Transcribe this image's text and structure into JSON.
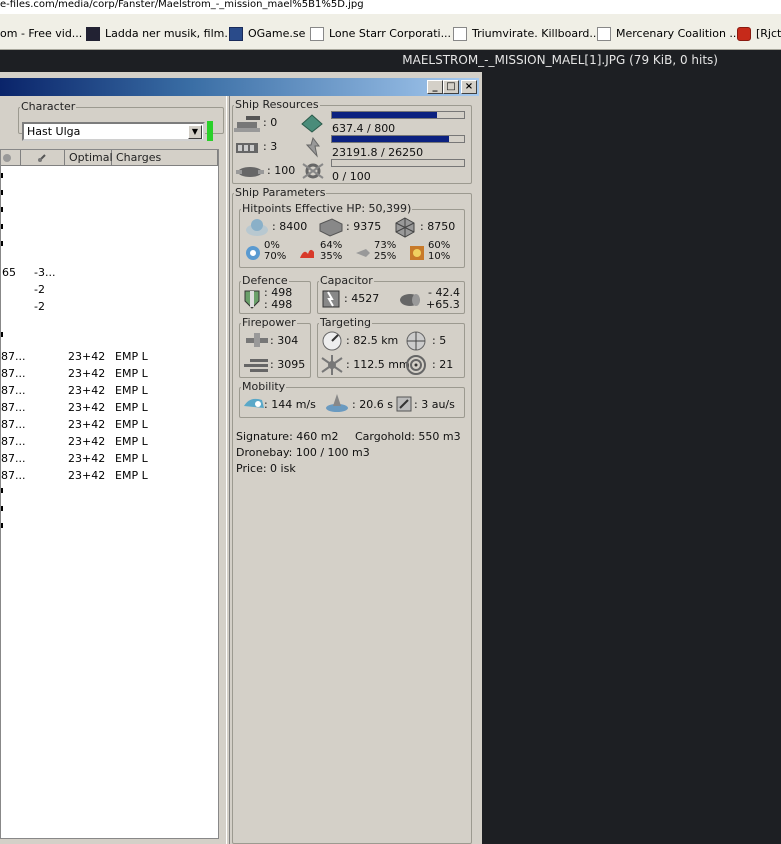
{
  "browser": {
    "url": "e-files.com/media/corp/Fanster/Maelstrom_-_mission_mael%5B1%5D.jpg",
    "bookmarks": [
      {
        "label": "om - Free vid..."
      },
      {
        "label": "Ladda ner musik, film..."
      },
      {
        "label": "OGame.se"
      },
      {
        "label": "Lone Starr Corporati..."
      },
      {
        "label": "Triumvirate. Killboard..."
      },
      {
        "label": "Mercenary Coalition ..."
      },
      {
        "label": "[Rjct"
      }
    ],
    "image_title": "MAELSTROM_-_MISSION_MAEL[1].JPG (79 KiB, 0 hits)"
  },
  "window": {
    "buttons": {
      "minimize": "_",
      "maximize": "□",
      "close": "×"
    }
  },
  "character": {
    "legend": "Character",
    "selected": "Hast Ulga"
  },
  "modules": {
    "headers": [
      "Optimal",
      "Charges"
    ],
    "rows": [
      {
        "a": "65",
        "b": "-3...",
        "optimal": "",
        "charges": ""
      },
      {
        "a": "",
        "b": "-2",
        "optimal": "",
        "charges": ""
      },
      {
        "a": "",
        "b": "-2",
        "optimal": "",
        "charges": ""
      },
      {
        "a": "87...",
        "b": "",
        "optimal": "23+42",
        "charges": "EMP L"
      },
      {
        "a": "87...",
        "b": "",
        "optimal": "23+42",
        "charges": "EMP L"
      },
      {
        "a": "87...",
        "b": "",
        "optimal": "23+42",
        "charges": "EMP L"
      },
      {
        "a": "87...",
        "b": "",
        "optimal": "23+42",
        "charges": "EMP L"
      },
      {
        "a": "87...",
        "b": "",
        "optimal": "23+42",
        "charges": "EMP L"
      },
      {
        "a": "87...",
        "b": "",
        "optimal": "23+42",
        "charges": "EMP L"
      },
      {
        "a": "87...",
        "b": "",
        "optimal": "23+42",
        "charges": "EMP L"
      },
      {
        "a": "87...",
        "b": "",
        "optimal": "23+42",
        "charges": "EMP L"
      }
    ]
  },
  "ship_resources": {
    "legend": "Ship Resources",
    "turret": ": 0",
    "launcher": ": 3",
    "drone": ": 100",
    "cpu": "637.4 / 800",
    "cpu_fraction": 0.797,
    "power": "23191.8 / 26250",
    "power_fraction": 0.883,
    "calibration": "0 / 100",
    "calibration_fraction": 0
  },
  "ship_parameters": {
    "legend": "Ship Parameters",
    "hitpoints": {
      "legend": "Hitpoints  Effective HP: 50,399)",
      "shield": ": 8400",
      "armor": ": 9375",
      "structure": ": 8750",
      "resists": [
        {
          "top": "0%",
          "bottom": "70%"
        },
        {
          "top": "64%",
          "bottom": "35%"
        },
        {
          "top": "73%",
          "bottom": "25%"
        },
        {
          "top": "60%",
          "bottom": "10%"
        }
      ]
    },
    "defence": {
      "legend": "Defence",
      "top": ": 498",
      "bottom": ": 498"
    },
    "capacitor": {
      "legend": "Capacitor",
      "amount": ": 4527",
      "top": "- 42.4",
      "bottom": "+65.3"
    },
    "firepower": {
      "legend": "Firepower",
      "volley": ": 304",
      "dps": ": 3095"
    },
    "targeting": {
      "legend": "Targeting",
      "range": ": 82.5 km",
      "targets": ": 5",
      "sig_res": ": 112.5 mm",
      "scan": ": 21"
    },
    "mobility": {
      "legend": "Mobility",
      "speed": ": 144 m/s",
      "align": ": 20.6 s",
      "warp": ": 3 au/s"
    },
    "signature": "Signature: 460 m2",
    "cargohold": "Cargohold: 550 m3",
    "dronebay": "Dronebay: 100 / 100 m3",
    "price": "Price: 0 isk"
  }
}
